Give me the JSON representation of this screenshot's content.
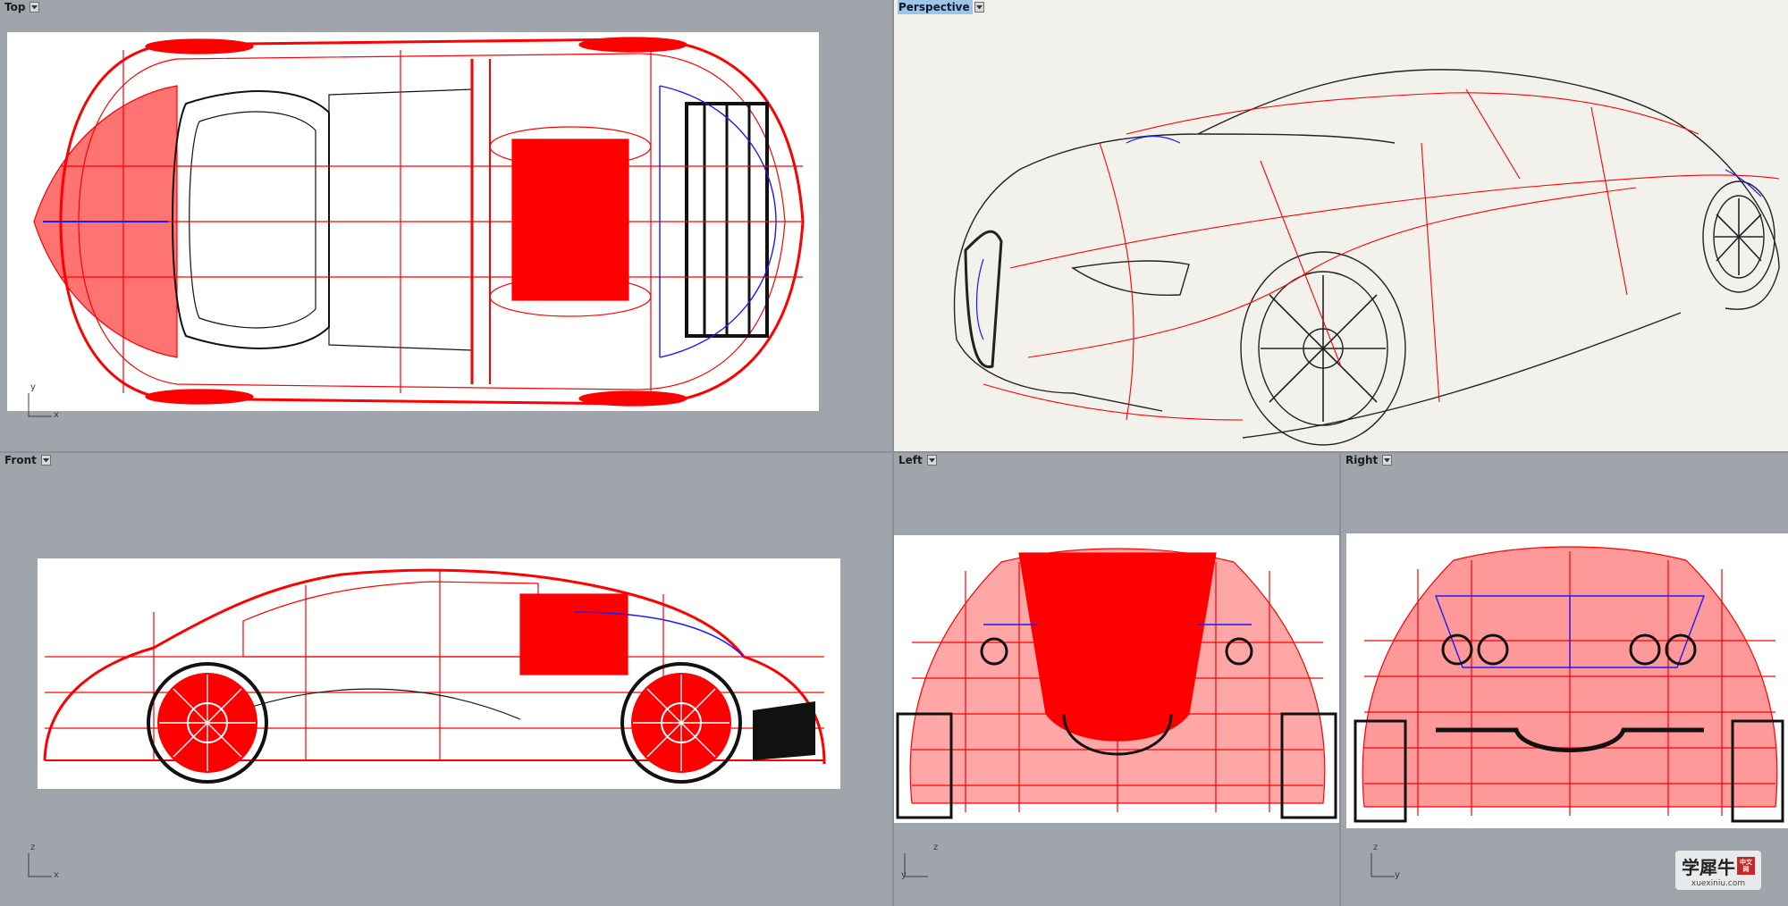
{
  "viewports": {
    "top": {
      "label": "Top",
      "axis_a": "y",
      "axis_b": "x",
      "active": false
    },
    "perspective": {
      "label": "Perspective",
      "active": true
    },
    "front": {
      "label": "Front",
      "axis_a": "z",
      "axis_b": "x",
      "active": false
    },
    "left": {
      "label": "Left",
      "axis_a": "z",
      "axis_b": "y",
      "active": false
    },
    "right": {
      "label": "Right",
      "axis_a": "z",
      "axis_b": "y",
      "active": false
    }
  },
  "watermark": {
    "main": "学犀牛",
    "box": "中文网",
    "sub": "xuexiniu.com"
  },
  "colors": {
    "background": "#a0a4ab",
    "wire_red": "#ff0000",
    "wire_blue": "#1a1aff",
    "wire_black": "#111111",
    "active_tab": "#9ec4e8"
  },
  "icons": {
    "viewport_menu": "chevron-down-icon",
    "axis": "axis-gizmo-icon"
  }
}
